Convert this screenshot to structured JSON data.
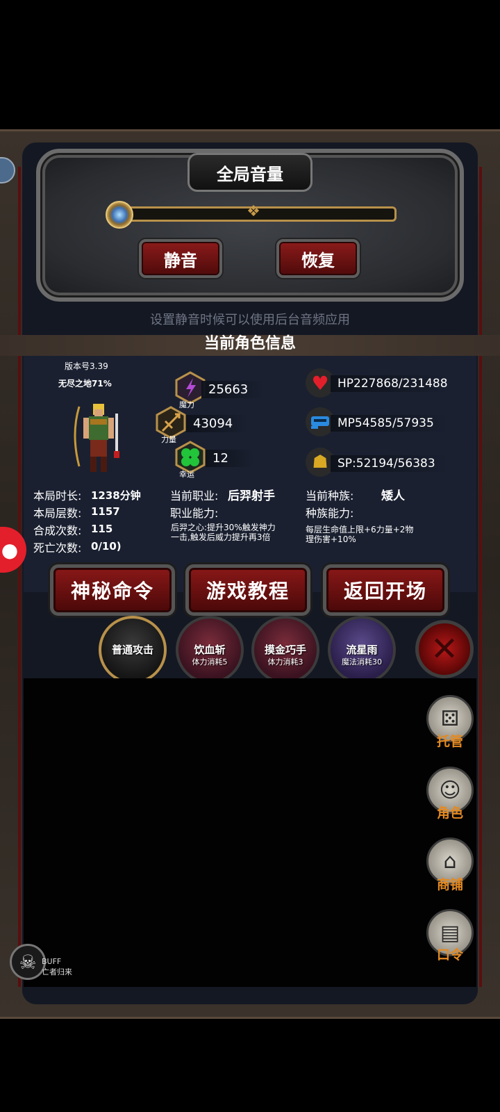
{
  "volume": {
    "title": "全局音量",
    "mute_label": "静音",
    "restore_label": "恢复",
    "hint": "设置静音时候可以使用后台音频应用"
  },
  "character": {
    "section_title": "当前角色信息",
    "version": "版本号3.39",
    "mode": "无尽之地71%",
    "stats": {
      "magic_label": "魔力",
      "magic": "25663",
      "strength_label": "力量",
      "strength": "43094",
      "luck_label": "幸运",
      "luck": "12"
    },
    "bars": {
      "hp": "HP227868/231488",
      "mp": "MP54585/57935",
      "sp": "SP:52194/56383"
    },
    "session": {
      "time_label": "本局时长:",
      "time": "1238分钟",
      "floor_label": "本局层数:",
      "floor": "1157",
      "craft_label": "合成次数:",
      "craft": "115",
      "death_label": "死亡次数:",
      "death": "0/10)"
    },
    "job": {
      "label": "当前职业:",
      "value": "后羿射手",
      "ability_label": "职业能力:",
      "ability_desc_1": "后羿之心:提升30%触发神力",
      "ability_desc_2": "一击,触发后威力提升再3倍"
    },
    "race": {
      "label": "当前种族:",
      "value": "矮人",
      "ability_label": "种族能力:",
      "ability_desc_1": "每层生命值上限+6力量+2物",
      "ability_desc_2": "理伤害+10%"
    }
  },
  "buttons": {
    "secret": "神秘命令",
    "tutorial": "游戏教程",
    "back": "返回开场"
  },
  "skills": [
    {
      "name": "普通攻击",
      "cost": ""
    },
    {
      "name": "饮血斩",
      "cost": "体力消耗5"
    },
    {
      "name": "摸金巧手",
      "cost": "体力消耗3"
    },
    {
      "name": "流星雨",
      "cost": "魔法消耗30"
    }
  ],
  "side_menu": {
    "auto": "托管",
    "role": "角色",
    "shop": "商铺",
    "code": "口令"
  },
  "buff": {
    "label": "BUFF",
    "name": "亡者归来"
  },
  "colors": {
    "accent_orange": "#e48a22",
    "button_red": "#8a1818",
    "panel_bg": "#1a2030"
  }
}
